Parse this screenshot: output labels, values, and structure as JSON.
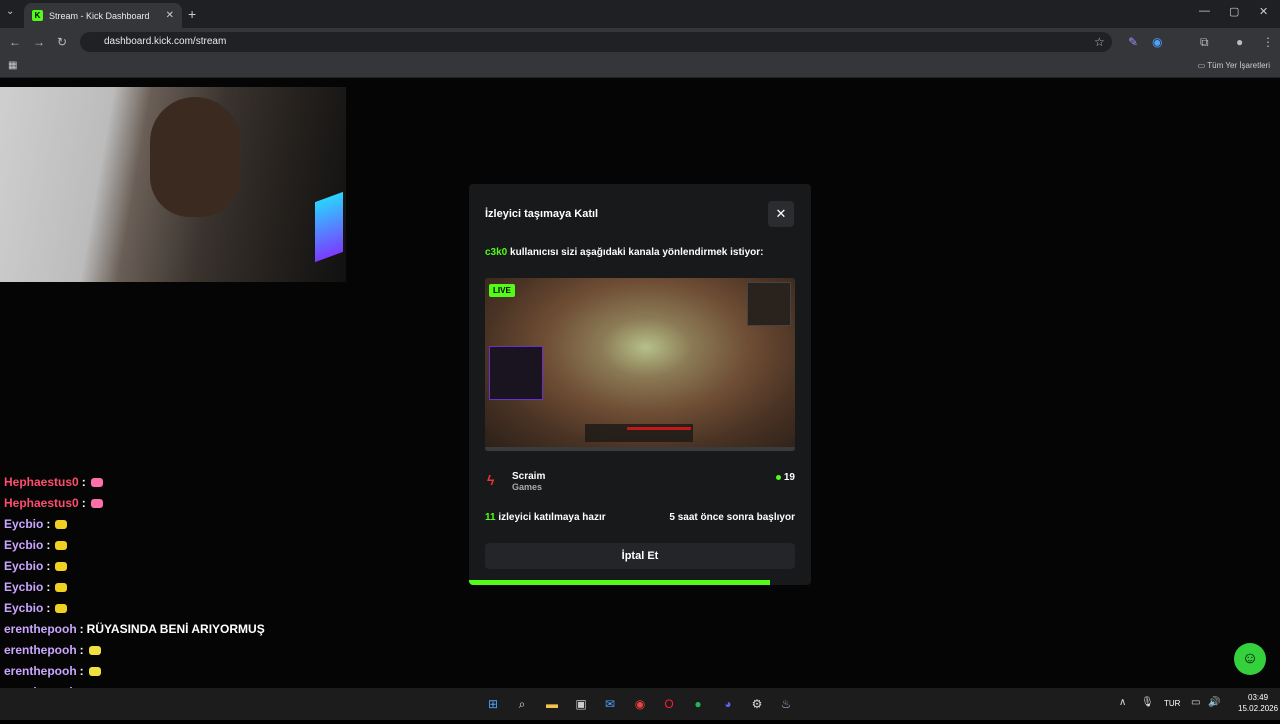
{
  "browser": {
    "tab_title": "Stream - Kick Dashboard",
    "url": "dashboard.kick.com/stream",
    "bookmarks_label": "Tüm Yer İşaretleri"
  },
  "chat": [
    {
      "user": "Hephaestus0",
      "color": "#ff4d6d",
      "message": "",
      "emote": "#ff6fa8"
    },
    {
      "user": "Hephaestus0",
      "color": "#ff4d6d",
      "message": "",
      "emote": "#ff6fa8"
    },
    {
      "user": "Eycbio",
      "color": "#c9a6ff",
      "message": "",
      "emote": "#f0d020"
    },
    {
      "user": "Eycbio",
      "color": "#c9a6ff",
      "message": "",
      "emote": "#f0d020"
    },
    {
      "user": "Eycbio",
      "color": "#c9a6ff",
      "message": "",
      "emote": "#f0d020"
    },
    {
      "user": "Eycbio",
      "color": "#c9a6ff",
      "message": "",
      "emote": "#f0d020"
    },
    {
      "user": "Eycbio",
      "color": "#c9a6ff",
      "message": "",
      "emote": "#f0d020"
    },
    {
      "user": "erenthepooh",
      "color": "#c9a6ff",
      "message": "RÜYASINDA BENİ ARIYORMUŞ",
      "emote": ""
    },
    {
      "user": "erenthepooh",
      "color": "#c9a6ff",
      "message": "",
      "emote": "#f0e040"
    },
    {
      "user": "erenthepooh",
      "color": "#c9a6ff",
      "message": "",
      "emote": "#f0e040"
    },
    {
      "user": "erenthepooh",
      "color": "#c9a6ff",
      "message": "",
      "emote": "#f0e040"
    },
    {
      "user": "erenthepooh",
      "color": "#c9a6ff",
      "message": "",
      "emote": "#f0e040"
    }
  ],
  "modal": {
    "title": "İzleyici taşımaya Katıl",
    "close_icon": "close-icon",
    "raider": "c3k0",
    "subtitle_rest": " kullanıcısı sizi aşağıdaki kanala yönlendirmek istiyor:",
    "live_badge": "LIVE",
    "channel_game": "Scraim",
    "channel_category": "Games",
    "viewer_count": "19",
    "ready_count": "11",
    "ready_text": " izleyici katılmaya hazır",
    "starts_text": "5 saat önce sonra başlıyor",
    "cancel_label": "İptal Et",
    "progress": 0.88,
    "accent": "#53fc18"
  },
  "taskbar": {
    "language": "TUR",
    "time": "03:49",
    "date": "15.02.2026"
  }
}
